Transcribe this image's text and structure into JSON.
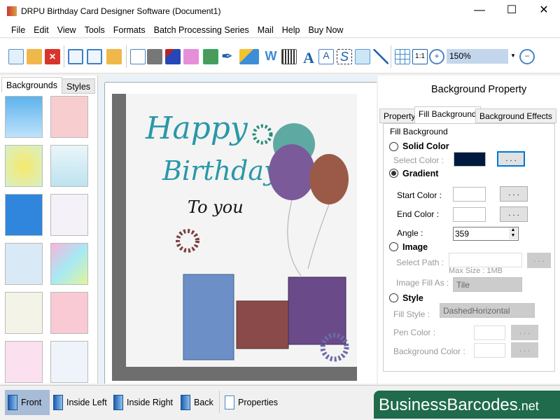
{
  "window": {
    "title": "DRPU Birthday Card Designer Software (Document1)",
    "minimize": "—",
    "maximize": "☐",
    "close": "✕"
  },
  "menu": [
    "File",
    "Edit",
    "View",
    "Tools",
    "Formats",
    "Batch Processing Series",
    "Mail",
    "Help",
    "Buy Now"
  ],
  "toolbar": {
    "icons": [
      "new-icon",
      "open-icon",
      "close-doc-icon",
      "save-icon",
      "save-as-icon",
      "export-icon",
      "page-setup-icon",
      "print-icon",
      "copy-icon",
      "gift-icon",
      "insert-image-icon",
      "pen-icon",
      "shape-icon",
      "watermark-icon",
      "barcode-icon",
      "text-icon",
      "text-art-icon",
      "signature-icon",
      "email-icon",
      "line-icon",
      "grid-icon",
      "actual-size-icon",
      "zoom-in-icon",
      "zoom-out-icon"
    ],
    "zoom": "150%"
  },
  "left_panel": {
    "tabs": [
      "Backgrounds",
      "Styles"
    ],
    "active_tab": "Backgrounds"
  },
  "card": {
    "line1": "Happy",
    "line2": "Birthday",
    "line3": "To you"
  },
  "right_panel": {
    "title": "Background Property",
    "tabs": [
      "Property",
      "Fill Background",
      "Background Effects"
    ],
    "active_tab": "Fill Background",
    "group": "Fill Background",
    "solid": {
      "label": "Solid Color",
      "select_color": "Select Color :",
      "color": "#001a3f",
      "btn": ". . ."
    },
    "gradient": {
      "label": "Gradient",
      "start": "Start Color :",
      "end": "End Color :",
      "angle_label": "Angle :",
      "angle": "359",
      "btn": ". . ."
    },
    "image": {
      "label": "Image",
      "path": "Select Path :",
      "max": "Max Size : 1MB",
      "fill_as": "Image Fill As :",
      "fill_value": "Tile",
      "btn": ". . ."
    },
    "style": {
      "label": "Style",
      "fill_style": "Fill Style :",
      "fill_value": "DashedHorizontal",
      "pen": "Pen Color :",
      "bg": "Background Color :",
      "btn": ". . ."
    },
    "selected": "Gradient"
  },
  "bottom": {
    "buttons": [
      "Front",
      "Inside Left",
      "Inside Right",
      "Back",
      "Properties"
    ],
    "active": "Front"
  },
  "brand": {
    "main": "BusinessBarcodes",
    "suffix": ".net"
  }
}
